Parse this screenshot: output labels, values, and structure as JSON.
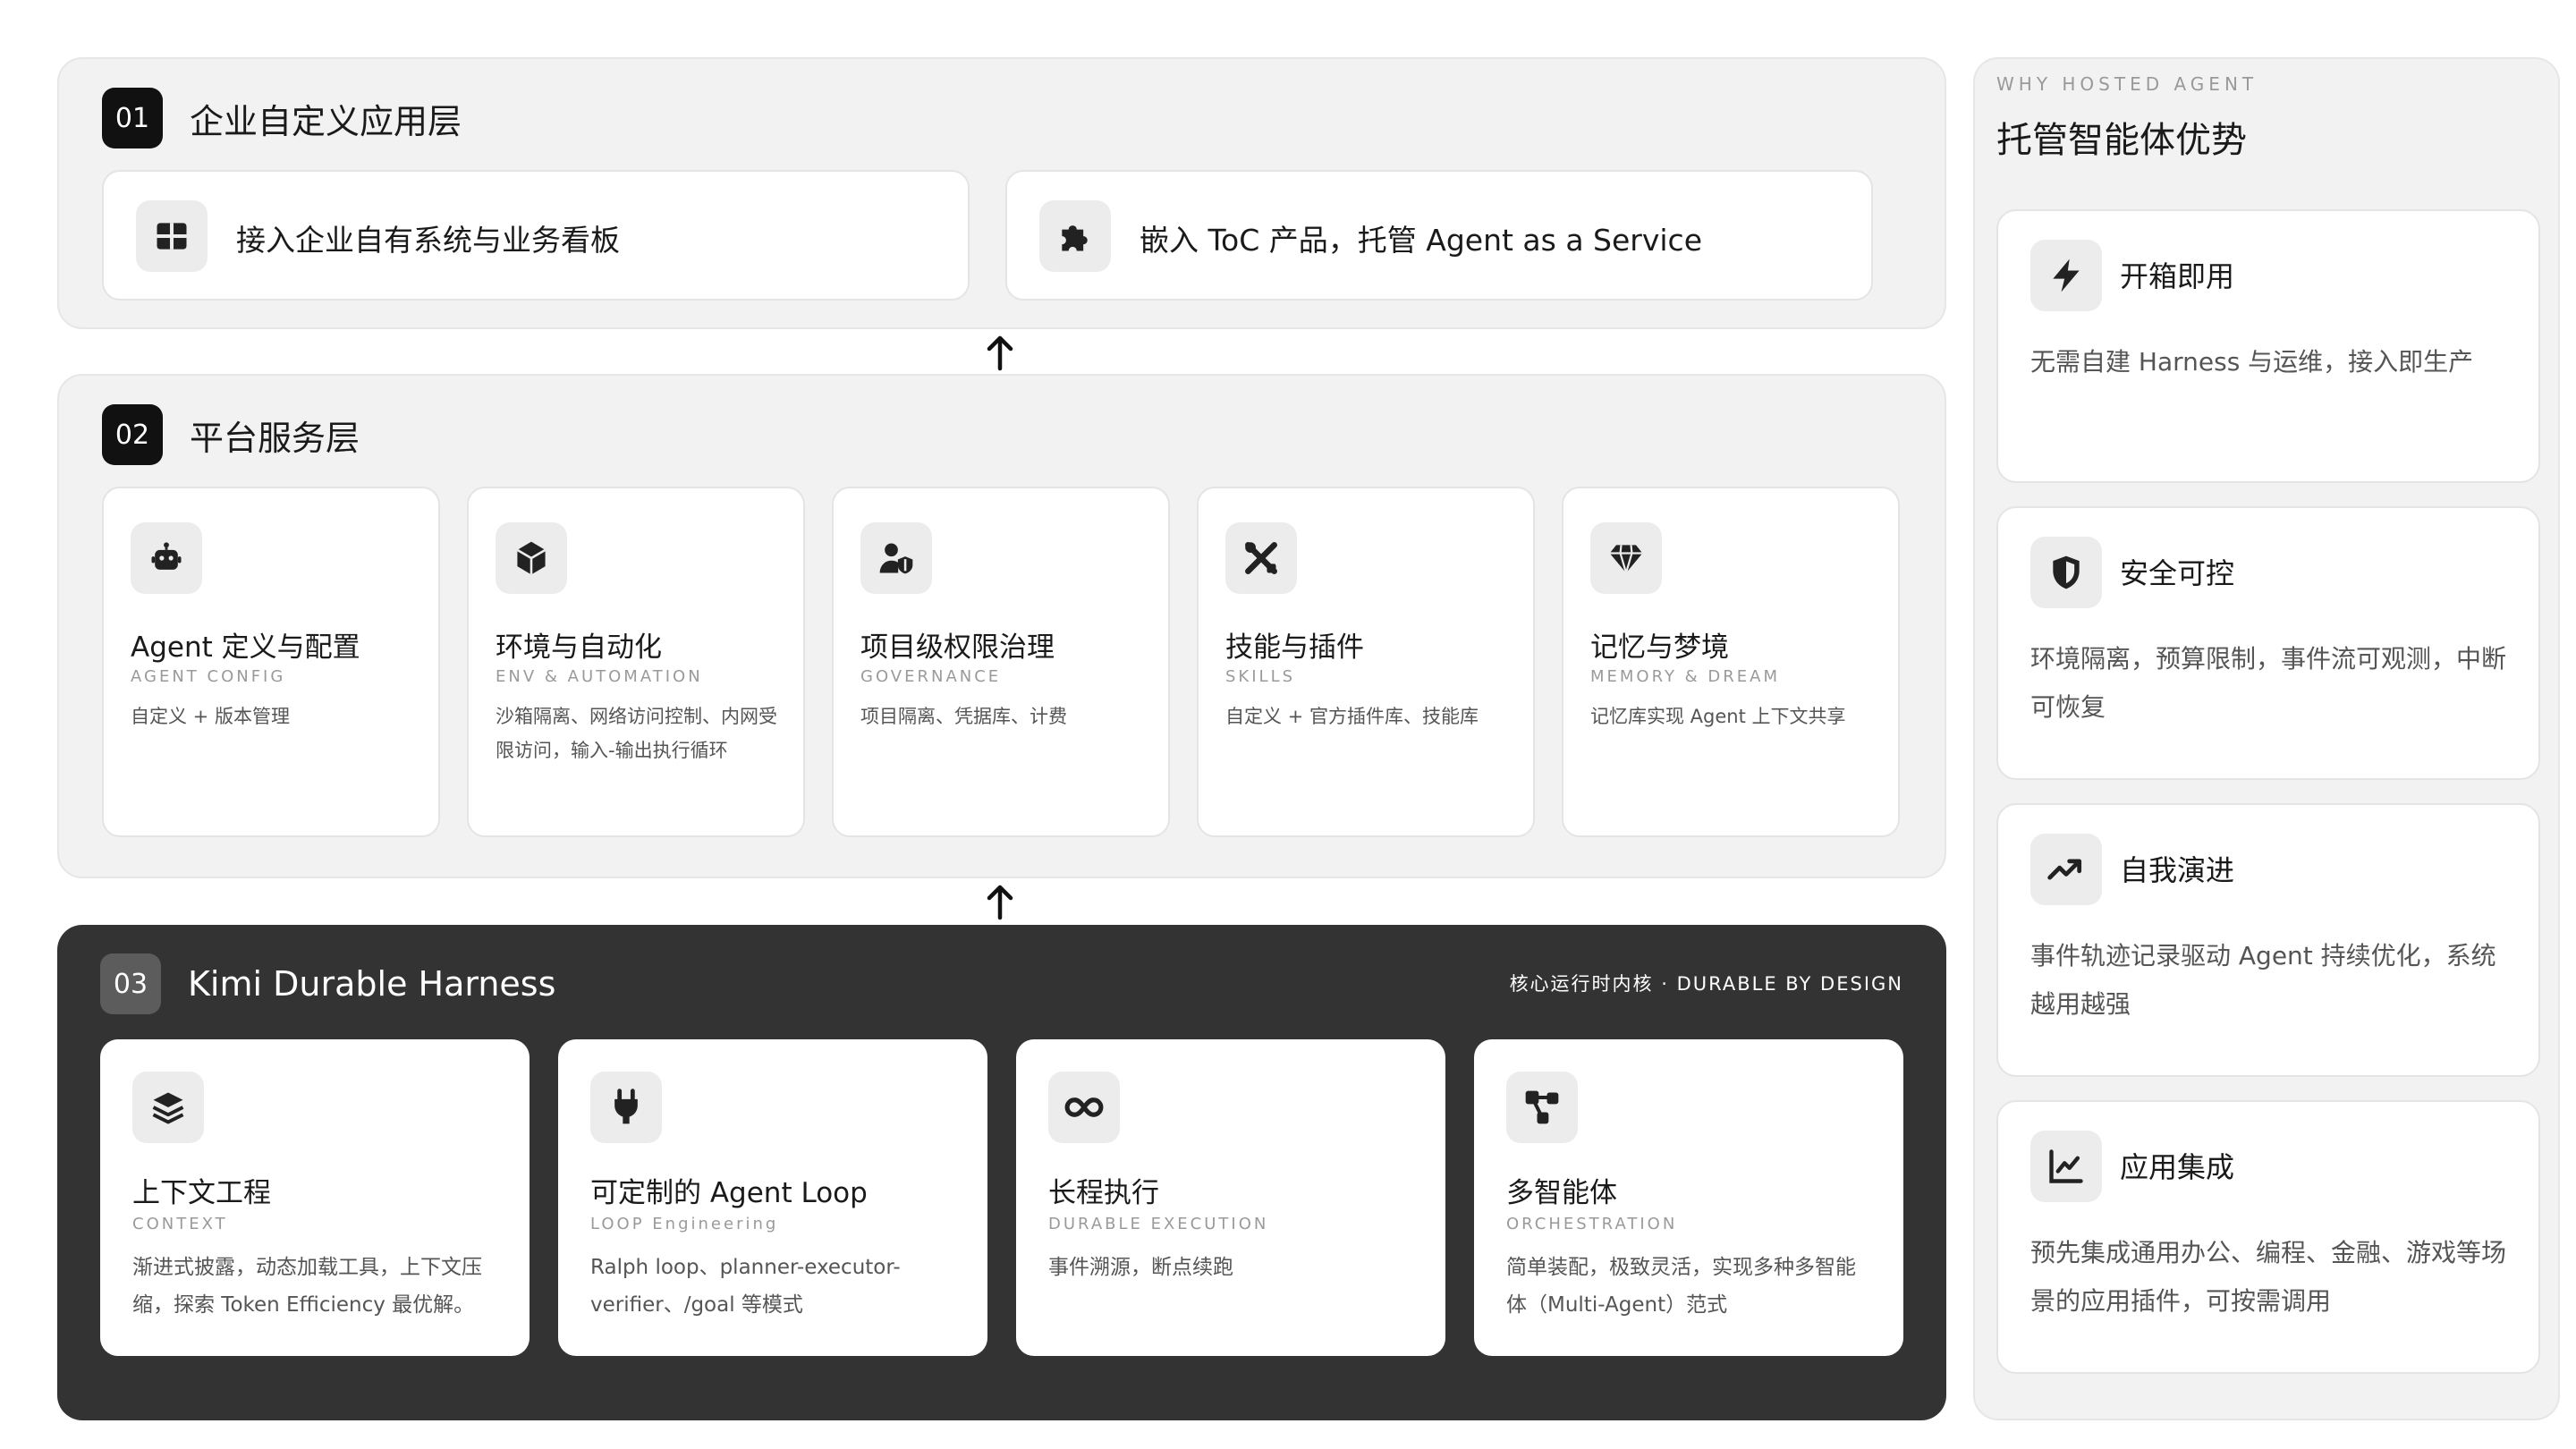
{
  "layers": [
    {
      "number": "01",
      "title": "企业自定义应用层",
      "cards": [
        {
          "icon": "grid-icon",
          "label": "接入企业自有系统与业务看板"
        },
        {
          "icon": "puzzle-icon",
          "label": "嵌入 ToC 产品，托管 Agent as a Service"
        }
      ]
    },
    {
      "number": "02",
      "title": "平台服务层",
      "cards": [
        {
          "icon": "robot-icon",
          "title": "Agent 定义与配置",
          "subtitle": "AGENT CONFIG",
          "desc": "自定义 + 版本管理"
        },
        {
          "icon": "cube-icon",
          "title": "环境与自动化",
          "subtitle": "ENV & AUTOMATION",
          "desc": "沙箱隔离、网络访问控制、内网受限访问，输入-输出执行循环"
        },
        {
          "icon": "user-shield-icon",
          "title": "项目级权限治理",
          "subtitle": "GOVERNANCE",
          "desc": "项目隔离、凭据库、计费"
        },
        {
          "icon": "tools-icon",
          "title": "技能与插件",
          "subtitle": "SKILLS",
          "desc": "自定义 + 官方插件库、技能库"
        },
        {
          "icon": "gem-icon",
          "title": "记忆与梦境",
          "subtitle": "MEMORY & DREAM",
          "desc": "记忆库实现 Agent 上下文共享"
        }
      ]
    },
    {
      "number": "03",
      "title": "Kimi Durable Harness",
      "tagline": "核心运行时内核 · DURABLE BY DESIGN",
      "cards": [
        {
          "icon": "layers-icon",
          "title": "上下文工程",
          "subtitle": "CONTEXT",
          "desc": "渐进式披露，动态加载工具，上下文压缩，探索 Token Efficiency 最优解。"
        },
        {
          "icon": "plug-icon",
          "title": "可定制的 Agent Loop",
          "subtitle": "LOOP Engineering",
          "desc": "Ralph loop、planner-executor-verifier、/goal 等模式"
        },
        {
          "icon": "infinity-icon",
          "title": "长程执行",
          "subtitle": "DURABLE EXECUTION",
          "desc": "事件溯源，断点续跑"
        },
        {
          "icon": "network-icon",
          "title": "多智能体",
          "subtitle": "ORCHESTRATION",
          "desc": "简单装配，极致灵活，实现多种多智能体（Multi-Agent）范式"
        }
      ]
    }
  ],
  "advantages": {
    "kicker": "WHY HOSTED AGENT",
    "title": "托管智能体优势",
    "items": [
      {
        "icon": "bolt-icon",
        "title": "开箱即用",
        "desc": "无需自建 Harness 与运维，接入即生产"
      },
      {
        "icon": "shield-icon",
        "title": "安全可控",
        "desc": "环境隔离，预算限制，事件流可观测，中断可恢复"
      },
      {
        "icon": "trend-up-icon",
        "title": "自我演进",
        "desc": "事件轨迹记录驱动 Agent 持续优化，系统越用越强"
      },
      {
        "icon": "chart-line-icon",
        "title": "应用集成",
        "desc": "预先集成通用办公、编程、金融、游戏等场景的应用插件，可按需调用"
      }
    ]
  },
  "colors": {
    "dark_panel": "#333333",
    "light_panel": "#f2f2f2",
    "badge": "#111111",
    "badge_dark_layer": "#5c5c5c"
  }
}
